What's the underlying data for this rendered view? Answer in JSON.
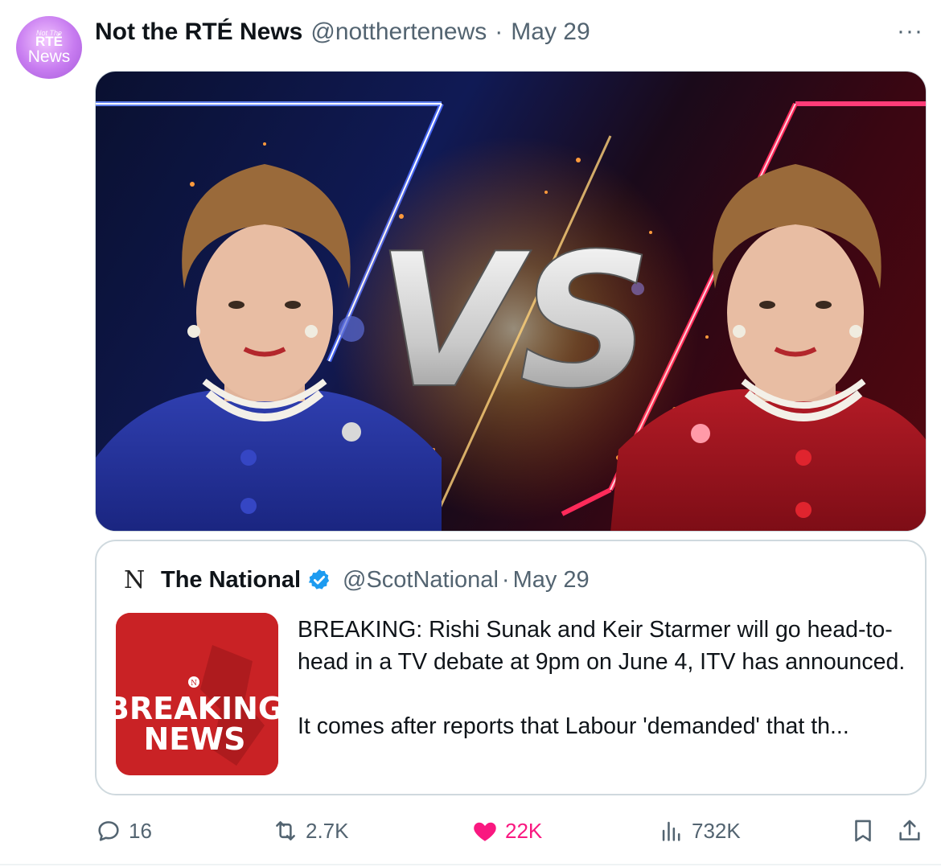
{
  "avatar": {
    "line1": "Not The",
    "line2": "RTÉ",
    "line3": "News"
  },
  "tweet": {
    "author_name": "Not the RTÉ News",
    "author_handle": "@notthertenews",
    "separator": "·",
    "date": "May 29",
    "more_label": "···"
  },
  "media": {
    "vs_text": "VS",
    "left_accent": "#1e3cff",
    "right_accent": "#ff2a5a"
  },
  "quoted": {
    "logo": "N",
    "author_name": "The National",
    "author_handle": "@ScotNational",
    "separator": "·",
    "date": "May 29",
    "thumbnail": {
      "line1": "BREAKING",
      "line2": "NEWS",
      "badge": "N"
    },
    "text_p1": "BREAKING: Rishi Sunak and Keir Starmer will go head-to-head in a TV debate at 9pm on June 4, ITV has announced.",
    "text_p2": "It comes after reports that Labour 'demanded' that th..."
  },
  "actions": {
    "replies": "16",
    "reposts": "2.7K",
    "likes": "22K",
    "views": "732K"
  },
  "colors": {
    "like": "#f91880",
    "verified": "#1d9bf0",
    "muted": "#536471"
  }
}
